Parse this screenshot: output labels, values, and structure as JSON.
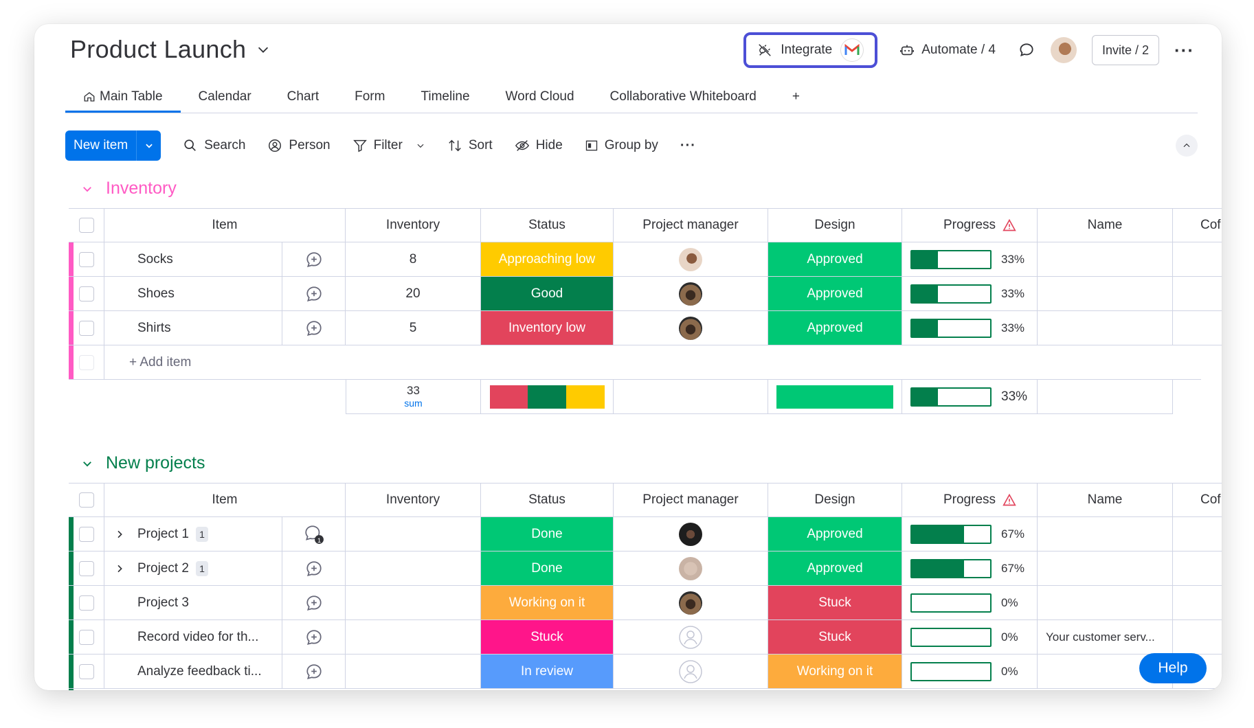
{
  "header": {
    "title": "Product Launch",
    "integrate_label": "Integrate",
    "automate_label": "Automate / 4",
    "invite_label": "Invite / 2"
  },
  "tabs": [
    {
      "label": "Main Table"
    },
    {
      "label": "Calendar"
    },
    {
      "label": "Chart"
    },
    {
      "label": "Form"
    },
    {
      "label": "Timeline"
    },
    {
      "label": "Word Cloud"
    },
    {
      "label": "Collaborative Whiteboard"
    },
    {
      "label": "+"
    }
  ],
  "toolbar": {
    "new_item": "New item",
    "search": "Search",
    "person": "Person",
    "filter": "Filter",
    "sort": "Sort",
    "hide": "Hide",
    "group_by": "Group by"
  },
  "columns": {
    "item": "Item",
    "inventory": "Inventory",
    "status": "Status",
    "project_manager": "Project manager",
    "design": "Design",
    "progress": "Progress",
    "name": "Name",
    "cof": "Cof"
  },
  "colors": {
    "accent": "#0073ea",
    "inventory_group": "#ff5ac4",
    "projects_group": "#037f4c",
    "approaching_low": "#ffcb00",
    "good": "#037f4c",
    "inventory_low": "#e2445c",
    "approved": "#00c875",
    "done": "#00c875",
    "working": "#fdab3d",
    "stuck_status": "#ff158a",
    "stuck_design": "#e2445c",
    "in_review": "#579bfc"
  },
  "groups": {
    "inventory": {
      "title": "Inventory",
      "rows": [
        {
          "item": "Socks",
          "inventory": "8",
          "status": "Approaching low",
          "design": "Approved",
          "progress": "33%"
        },
        {
          "item": "Shoes",
          "inventory": "20",
          "status": "Good",
          "design": "Approved",
          "progress": "33%"
        },
        {
          "item": "Shirts",
          "inventory": "5",
          "status": "Inventory low",
          "design": "Approved",
          "progress": "33%"
        }
      ],
      "add_item": "+ Add item",
      "summary": {
        "sum_value": "33",
        "sum_label": "sum",
        "progress": "33%"
      }
    },
    "projects": {
      "title": "New projects",
      "rows": [
        {
          "item": "Project 1",
          "badge": "1",
          "status": "Done",
          "design": "Approved",
          "progress": "67%",
          "name": ""
        },
        {
          "item": "Project 2",
          "badge": "1",
          "status": "Done",
          "design": "Approved",
          "progress": "67%",
          "name": ""
        },
        {
          "item": "Project 3",
          "status": "Working on it",
          "design": "Stuck",
          "progress": "0%",
          "name": ""
        },
        {
          "item": "Record video for th...",
          "status": "Stuck",
          "design": "Stuck",
          "progress": "0%",
          "name": "Your customer serv..."
        },
        {
          "item": "Analyze feedback ti...",
          "status": "In review",
          "design": "Working on it",
          "progress": "0%",
          "name": ""
        }
      ]
    }
  },
  "help_label": "Help"
}
